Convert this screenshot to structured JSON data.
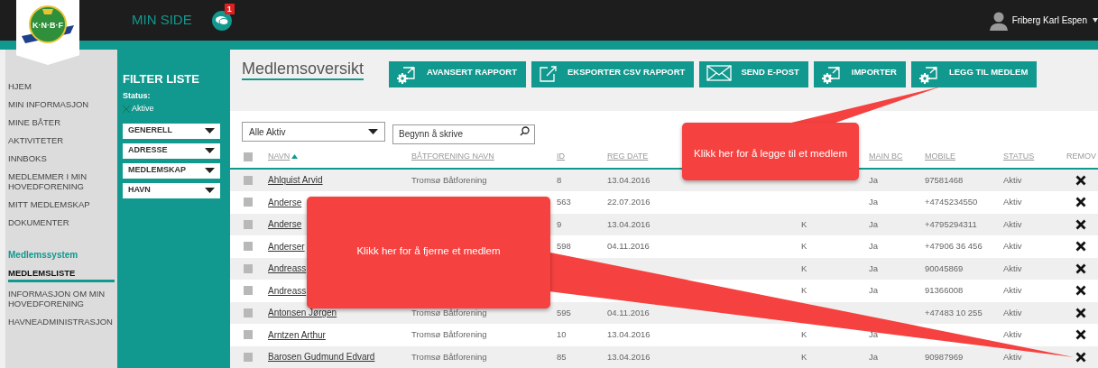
{
  "top_bar": {
    "logo_text": "K·N·B·F",
    "title": "MIN SIDE",
    "chat_badge": "1",
    "user_name": "Friberg Karl Espen"
  },
  "sidebar": {
    "items": [
      {
        "label": "HJEM",
        "selected": false
      },
      {
        "label": "MIN INFORMASJON",
        "selected": false
      },
      {
        "label": "MINE BÅTER",
        "selected": false
      },
      {
        "label": "AKTIVITETER",
        "selected": false
      },
      {
        "label": "INNBOKS",
        "selected": false
      },
      {
        "label": "MEDLEMMER I MIN HOVEDFORENING",
        "selected": false
      },
      {
        "label": "MITT MEDLEMSKAP",
        "selected": false
      },
      {
        "label": "DOKUMENTER",
        "selected": false
      }
    ],
    "section_title": "Medlemssystem",
    "section_items": [
      {
        "label": "MEDLEMSLISTE",
        "selected": true
      },
      {
        "label": "INFORMASJON OM MIN HOVEDFORENING",
        "selected": false
      },
      {
        "label": "HAVNEADMINISTRASJON",
        "selected": false
      }
    ]
  },
  "filter": {
    "title": "FILTER LISTE",
    "status_label": "Status:",
    "status_chip": "Aktive",
    "dropdowns": [
      "GENERELL",
      "ADRESSE",
      "MEDLEMSKAP",
      "HAVN"
    ]
  },
  "page_title": "Medlemsoversikt",
  "toolbar": [
    {
      "label": "AVANSERT RAPPORT",
      "kind": "gear"
    },
    {
      "label": "EKSPORTER CSV RAPPORT",
      "kind": "export"
    },
    {
      "label": "SEND E-POST",
      "kind": "mail"
    },
    {
      "label": "IMPORTER",
      "kind": "gear"
    },
    {
      "label": "LEGG TIL MEDLEM",
      "kind": "gear"
    }
  ],
  "list_filter": {
    "value": "Alle Aktiv"
  },
  "search": {
    "placeholder": "Begynn å skrive"
  },
  "table": {
    "header_checked": false,
    "columns": [
      {
        "label": "NAVN",
        "sort_ascending": true
      },
      {
        "label": "BÅTFORENING NAVN"
      },
      {
        "label": "ID"
      },
      {
        "label": "REG DATE"
      },
      {},
      {
        "label": "MAIN BC"
      },
      {
        "label": "MOBILE"
      },
      {
        "label": "STATUS"
      },
      {
        "label": "REMOV"
      }
    ],
    "rows": [
      {
        "checked": false,
        "cells": [
          "Ahlquist Arvid",
          "Tromsø Båtforening",
          "8",
          "13.04.2016",
          null,
          "Ja",
          "97581468",
          "Aktiv"
        ]
      },
      {
        "checked": false,
        "cells": [
          "Anderse",
          null,
          "563",
          "22.07.2016",
          null,
          "Ja",
          "+4745234550",
          "Aktiv"
        ]
      },
      {
        "checked": false,
        "cells": [
          "Anderse",
          null,
          "9",
          "13.04.2016",
          "K",
          "Ja",
          "+4795294311",
          "Aktiv"
        ]
      },
      {
        "checked": false,
        "cells": [
          "Anderser",
          null,
          "598",
          "04.11.2016",
          "K",
          "Ja",
          "+47906 36 456",
          "Aktiv"
        ]
      },
      {
        "checked": false,
        "cells": [
          "Andreass",
          null,
          null,
          null,
          "K",
          "Ja",
          "90045869",
          "Aktiv"
        ]
      },
      {
        "checked": false,
        "cells": [
          "Andreass",
          null,
          null,
          null,
          "K",
          "Ja",
          "91366008",
          "Aktiv"
        ]
      },
      {
        "checked": false,
        "cells": [
          "Antonsen Jørgen",
          "Tromsø Båtforening",
          "595",
          "04.11.2016",
          null,
          null,
          "+47483 10 255",
          "Aktiv"
        ]
      },
      {
        "checked": false,
        "cells": [
          "Arntzen Arthur",
          "Tromsø Båtforening",
          "10",
          "13.04.2016",
          "K",
          "Ja",
          null,
          "Aktiv"
        ]
      },
      {
        "checked": false,
        "cells": [
          "Barosen Gudmund Edvard",
          "Tromsø Båtforening",
          "85",
          "13.04.2016",
          "K",
          "Ja",
          "90987969",
          "Aktiv"
        ]
      }
    ]
  },
  "callouts": [
    {
      "text": "Klikk her for å legge til et medlem",
      "kind": "up"
    },
    {
      "text": "Klikk her for å fjerne et medlem",
      "kind": "right"
    }
  ]
}
